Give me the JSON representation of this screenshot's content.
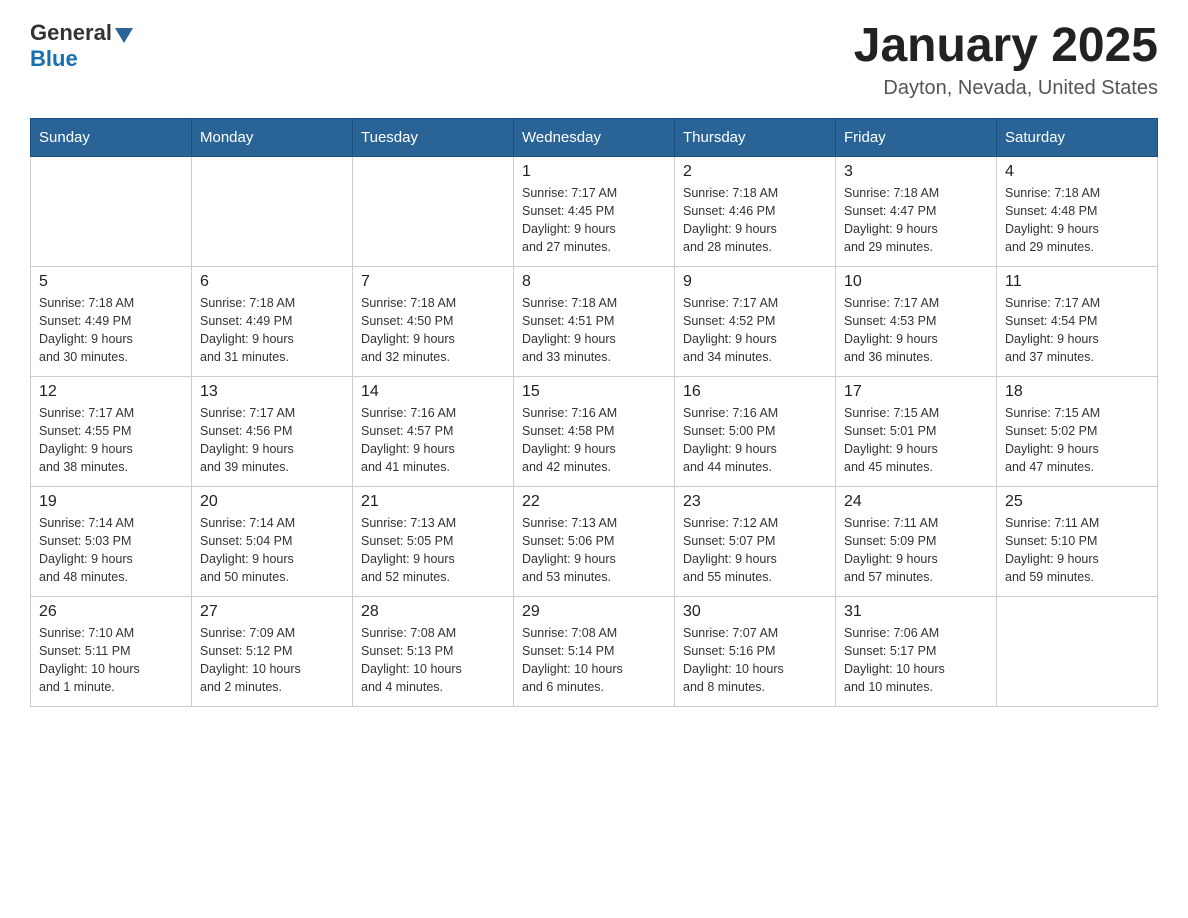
{
  "header": {
    "logo": {
      "general": "General",
      "blue": "Blue"
    },
    "month": "January 2025",
    "location": "Dayton, Nevada, United States"
  },
  "weekdays": [
    "Sunday",
    "Monday",
    "Tuesday",
    "Wednesday",
    "Thursday",
    "Friday",
    "Saturday"
  ],
  "weeks": [
    [
      {
        "day": "",
        "info": ""
      },
      {
        "day": "",
        "info": ""
      },
      {
        "day": "",
        "info": ""
      },
      {
        "day": "1",
        "info": "Sunrise: 7:17 AM\nSunset: 4:45 PM\nDaylight: 9 hours\nand 27 minutes."
      },
      {
        "day": "2",
        "info": "Sunrise: 7:18 AM\nSunset: 4:46 PM\nDaylight: 9 hours\nand 28 minutes."
      },
      {
        "day": "3",
        "info": "Sunrise: 7:18 AM\nSunset: 4:47 PM\nDaylight: 9 hours\nand 29 minutes."
      },
      {
        "day": "4",
        "info": "Sunrise: 7:18 AM\nSunset: 4:48 PM\nDaylight: 9 hours\nand 29 minutes."
      }
    ],
    [
      {
        "day": "5",
        "info": "Sunrise: 7:18 AM\nSunset: 4:49 PM\nDaylight: 9 hours\nand 30 minutes."
      },
      {
        "day": "6",
        "info": "Sunrise: 7:18 AM\nSunset: 4:49 PM\nDaylight: 9 hours\nand 31 minutes."
      },
      {
        "day": "7",
        "info": "Sunrise: 7:18 AM\nSunset: 4:50 PM\nDaylight: 9 hours\nand 32 minutes."
      },
      {
        "day": "8",
        "info": "Sunrise: 7:18 AM\nSunset: 4:51 PM\nDaylight: 9 hours\nand 33 minutes."
      },
      {
        "day": "9",
        "info": "Sunrise: 7:17 AM\nSunset: 4:52 PM\nDaylight: 9 hours\nand 34 minutes."
      },
      {
        "day": "10",
        "info": "Sunrise: 7:17 AM\nSunset: 4:53 PM\nDaylight: 9 hours\nand 36 minutes."
      },
      {
        "day": "11",
        "info": "Sunrise: 7:17 AM\nSunset: 4:54 PM\nDaylight: 9 hours\nand 37 minutes."
      }
    ],
    [
      {
        "day": "12",
        "info": "Sunrise: 7:17 AM\nSunset: 4:55 PM\nDaylight: 9 hours\nand 38 minutes."
      },
      {
        "day": "13",
        "info": "Sunrise: 7:17 AM\nSunset: 4:56 PM\nDaylight: 9 hours\nand 39 minutes."
      },
      {
        "day": "14",
        "info": "Sunrise: 7:16 AM\nSunset: 4:57 PM\nDaylight: 9 hours\nand 41 minutes."
      },
      {
        "day": "15",
        "info": "Sunrise: 7:16 AM\nSunset: 4:58 PM\nDaylight: 9 hours\nand 42 minutes."
      },
      {
        "day": "16",
        "info": "Sunrise: 7:16 AM\nSunset: 5:00 PM\nDaylight: 9 hours\nand 44 minutes."
      },
      {
        "day": "17",
        "info": "Sunrise: 7:15 AM\nSunset: 5:01 PM\nDaylight: 9 hours\nand 45 minutes."
      },
      {
        "day": "18",
        "info": "Sunrise: 7:15 AM\nSunset: 5:02 PM\nDaylight: 9 hours\nand 47 minutes."
      }
    ],
    [
      {
        "day": "19",
        "info": "Sunrise: 7:14 AM\nSunset: 5:03 PM\nDaylight: 9 hours\nand 48 minutes."
      },
      {
        "day": "20",
        "info": "Sunrise: 7:14 AM\nSunset: 5:04 PM\nDaylight: 9 hours\nand 50 minutes."
      },
      {
        "day": "21",
        "info": "Sunrise: 7:13 AM\nSunset: 5:05 PM\nDaylight: 9 hours\nand 52 minutes."
      },
      {
        "day": "22",
        "info": "Sunrise: 7:13 AM\nSunset: 5:06 PM\nDaylight: 9 hours\nand 53 minutes."
      },
      {
        "day": "23",
        "info": "Sunrise: 7:12 AM\nSunset: 5:07 PM\nDaylight: 9 hours\nand 55 minutes."
      },
      {
        "day": "24",
        "info": "Sunrise: 7:11 AM\nSunset: 5:09 PM\nDaylight: 9 hours\nand 57 minutes."
      },
      {
        "day": "25",
        "info": "Sunrise: 7:11 AM\nSunset: 5:10 PM\nDaylight: 9 hours\nand 59 minutes."
      }
    ],
    [
      {
        "day": "26",
        "info": "Sunrise: 7:10 AM\nSunset: 5:11 PM\nDaylight: 10 hours\nand 1 minute."
      },
      {
        "day": "27",
        "info": "Sunrise: 7:09 AM\nSunset: 5:12 PM\nDaylight: 10 hours\nand 2 minutes."
      },
      {
        "day": "28",
        "info": "Sunrise: 7:08 AM\nSunset: 5:13 PM\nDaylight: 10 hours\nand 4 minutes."
      },
      {
        "day": "29",
        "info": "Sunrise: 7:08 AM\nSunset: 5:14 PM\nDaylight: 10 hours\nand 6 minutes."
      },
      {
        "day": "30",
        "info": "Sunrise: 7:07 AM\nSunset: 5:16 PM\nDaylight: 10 hours\nand 8 minutes."
      },
      {
        "day": "31",
        "info": "Sunrise: 7:06 AM\nSunset: 5:17 PM\nDaylight: 10 hours\nand 10 minutes."
      },
      {
        "day": "",
        "info": ""
      }
    ]
  ]
}
